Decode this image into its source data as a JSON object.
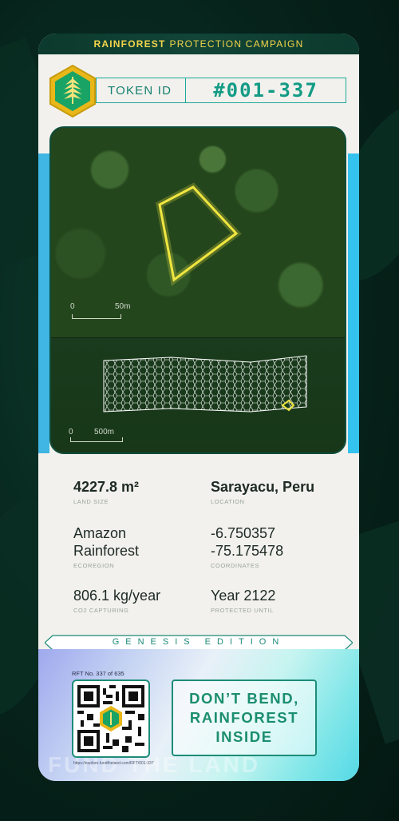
{
  "header": {
    "brand": "RAINFOREST",
    "rest": "PROTECTION CAMPAIGN"
  },
  "token": {
    "label": "TOKEN ID",
    "value": "#001-337"
  },
  "map": {
    "top_scale_zero": "0",
    "top_scale_value": "50m",
    "bottom_scale_zero": "0",
    "bottom_scale_value": "500m"
  },
  "stats": {
    "land_size": {
      "value": "4227.8 m²",
      "label": "LAND SIZE"
    },
    "location": {
      "value": "Sarayacu, Peru",
      "label": "LOCATION"
    },
    "ecoregion": {
      "value_line1": "Amazon",
      "value_line2": "Rainforest",
      "label": "ECOREGION"
    },
    "coordinates": {
      "value_line1": "-6.750357",
      "value_line2": "-75.175478",
      "label": "COORDINATES"
    },
    "co2": {
      "value": "806.1 kg/year",
      "label": "CO2 CAPTURING"
    },
    "protected": {
      "value": "Year 2122",
      "label": "PROTECTED UNTIL"
    }
  },
  "edition": "GENESIS EDITION",
  "holo": {
    "rft": "RFT No. 337 of 635",
    "url": "https://explore.fundtheland.com/RFT/001-337",
    "slogan_line1": "DON’T BEND,",
    "slogan_line2": "RAINFOREST",
    "slogan_line3": "INSIDE",
    "watermark": "FUND THE LAND"
  },
  "colors": {
    "accent": "#139b85",
    "gold": "#f3d54b",
    "dark": "#0c3a2d"
  }
}
